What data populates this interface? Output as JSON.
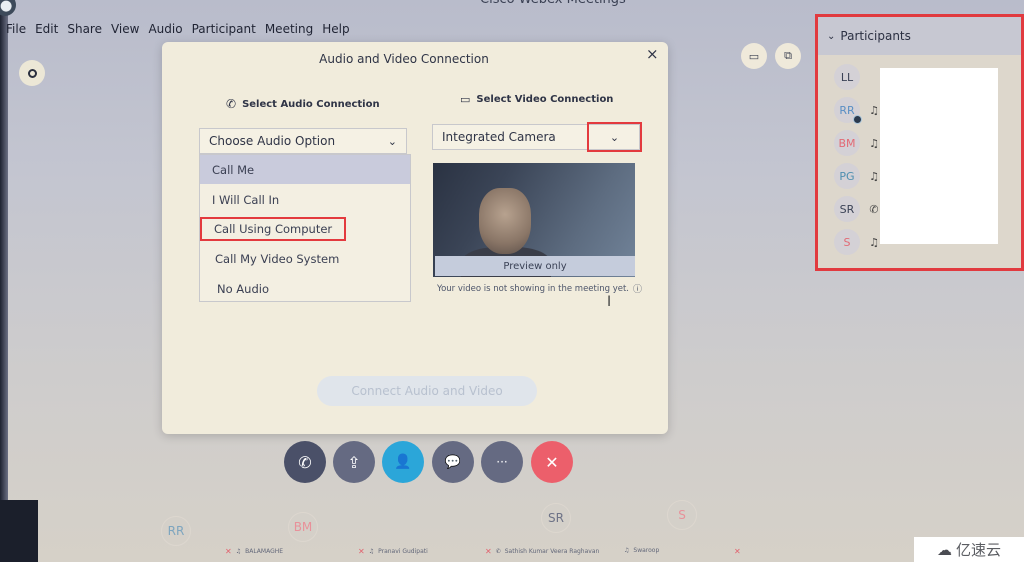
{
  "window": {
    "title": "Cisco Webex Meetings"
  },
  "menu": [
    {
      "label": "File"
    },
    {
      "label": "Edit"
    },
    {
      "label": "Share"
    },
    {
      "label": "View"
    },
    {
      "label": "Audio"
    },
    {
      "label": "Participant"
    },
    {
      "label": "Meeting"
    },
    {
      "label": "Help"
    }
  ],
  "dialog": {
    "title": "Audio and Video Connection",
    "close_icon": "×",
    "audio": {
      "heading": "Select Audio Connection",
      "select_value": "Choose Audio Option",
      "options": [
        {
          "label": "Call Me",
          "selected": true
        },
        {
          "label": "I Will Call In"
        },
        {
          "label": "Call Using Computer",
          "highlighted": true
        },
        {
          "label": "Call My Video System"
        },
        {
          "label": "No Audio"
        }
      ]
    },
    "video": {
      "heading": "Select Video Connection",
      "select_value": "Integrated Camera",
      "preview_label": "Preview only",
      "note": "Your video is not showing in the meeting yet."
    },
    "connect_button": "Connect Audio and Video"
  },
  "toolbar": {
    "buttons": [
      {
        "name": "audio-video",
        "icon": "phone-video-icon",
        "glyph": "✆"
      },
      {
        "name": "share",
        "icon": "share-icon",
        "glyph": "⇪"
      },
      {
        "name": "participants",
        "icon": "participants-icon",
        "glyph": "👤"
      },
      {
        "name": "chat",
        "icon": "chat-icon",
        "glyph": "💬"
      },
      {
        "name": "more",
        "icon": "more-icon",
        "glyph": "···"
      },
      {
        "name": "leave",
        "icon": "close-icon",
        "glyph": "✕"
      }
    ]
  },
  "participants_panel": {
    "title": "Participants",
    "items": [
      {
        "initials": "LL",
        "color": "#3b4256",
        "status": ""
      },
      {
        "initials": "RR",
        "color": "#5a8fc4",
        "status": "headset",
        "presenter": true
      },
      {
        "initials": "BM",
        "color": "#e26a75",
        "status": "headset"
      },
      {
        "initials": "PG",
        "color": "#4f8fb0",
        "status": "headset"
      },
      {
        "initials": "SR",
        "color": "#3b4256",
        "status": "phone"
      },
      {
        "initials": "S",
        "color": "#e26a75",
        "status": "headset"
      }
    ]
  },
  "bottom_strip": {
    "avatars": [
      {
        "initials": "RR",
        "color": "#7ea5bf"
      },
      {
        "initials": "BM",
        "color": "#e8919a"
      },
      {
        "initials": "SR",
        "color": "#6e7387"
      },
      {
        "initials": "S",
        "color": "#e8919a"
      }
    ],
    "names": [
      {
        "label": "BALAMAGHE"
      },
      {
        "label": "Pranavi Gudipati"
      },
      {
        "label": "Sathish Kumar Veera Raghavan"
      },
      {
        "label": "Swaroop"
      }
    ]
  },
  "watermark": {
    "text": "亿速云"
  }
}
